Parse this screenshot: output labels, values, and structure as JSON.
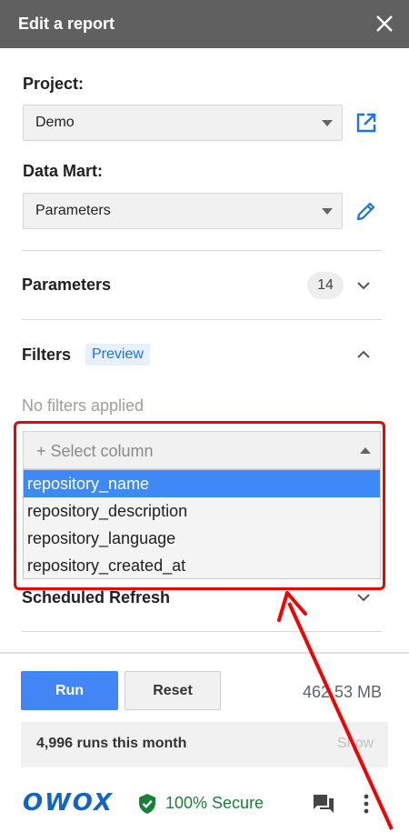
{
  "header": {
    "title": "Edit a report"
  },
  "project": {
    "label": "Project:",
    "value": "Demo"
  },
  "datamart": {
    "label": "Data Mart:",
    "value": "Parameters"
  },
  "parameters": {
    "title": "Parameters",
    "count": "14"
  },
  "filters": {
    "title": "Filters",
    "preview_badge": "Preview",
    "empty_text": "No filters applied",
    "select_placeholder": "+ Select column",
    "options": [
      "repository_name",
      "repository_description",
      "repository_language",
      "repository_created_at"
    ]
  },
  "scheduled": {
    "title": "Scheduled Refresh"
  },
  "footer": {
    "run_label": "Run",
    "reset_label": "Reset",
    "data_size": "462.53 MB",
    "runs_text": "4,996 runs this month",
    "show_label": "Show",
    "brand": "OWOX",
    "secure_text": "100% Secure"
  },
  "colors": {
    "header_bg": "#606060",
    "accent_blue": "#4285f4",
    "highlight_red": "#f40000",
    "secure_green": "#188038"
  }
}
